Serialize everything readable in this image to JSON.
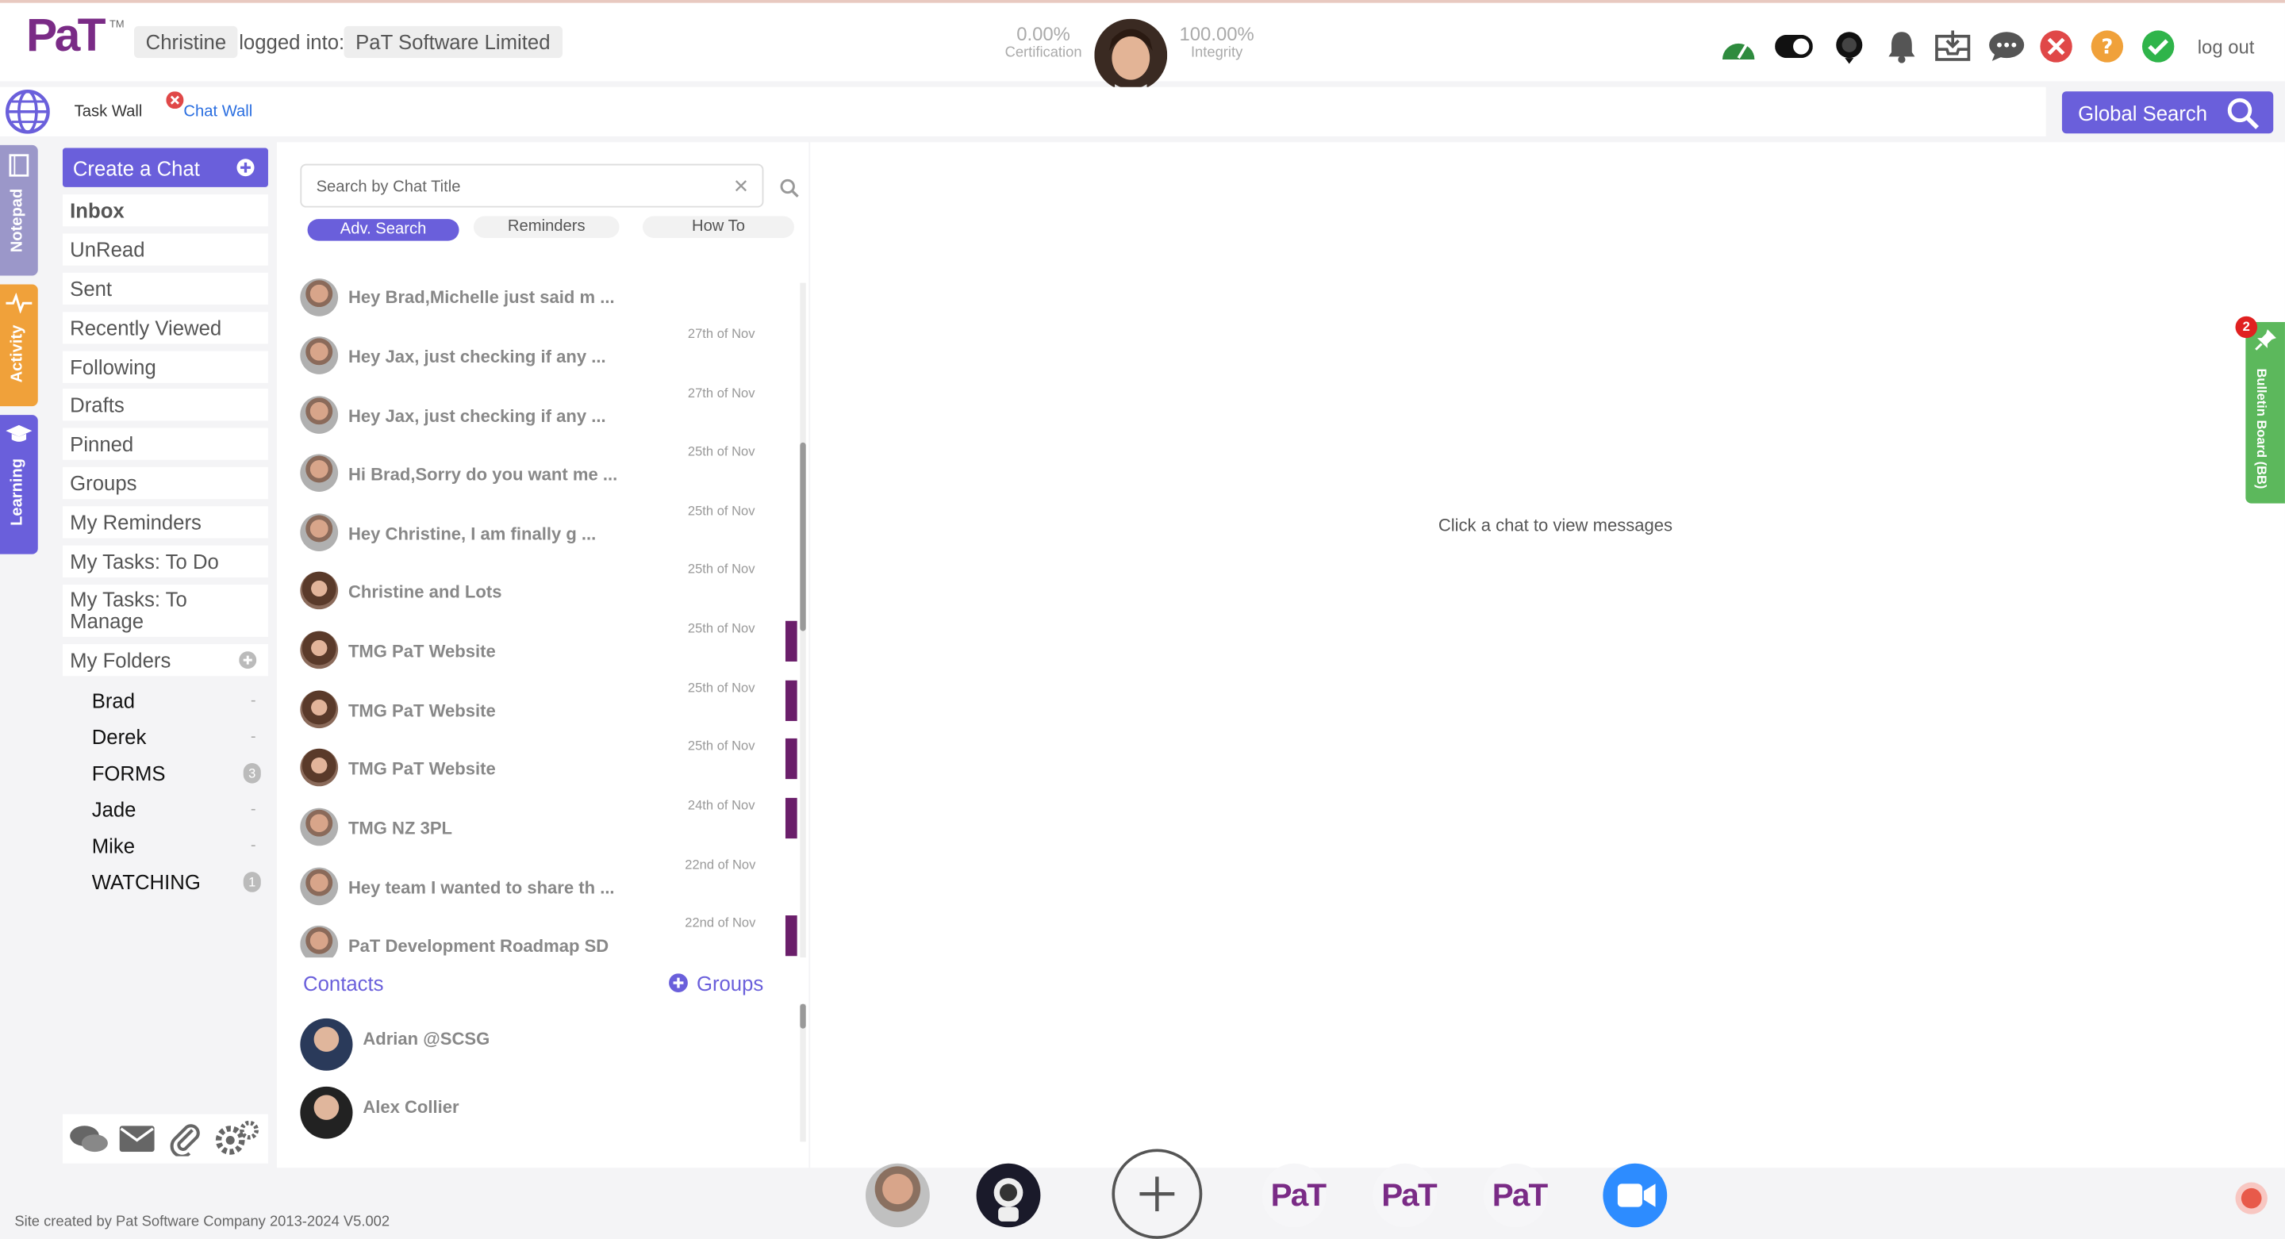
{
  "header": {
    "username": "Christine",
    "logged_into_label": "logged into:",
    "company": "PaT Software Limited",
    "certification_value": "0.00%",
    "certification_label": "Certification",
    "integrity_value": "100.00%",
    "integrity_label": "Integrity",
    "logout_label": "log out",
    "logo_text": "PaT",
    "logo_tm": "TM"
  },
  "subbar": {
    "task_wall": "Task Wall",
    "chat_wall": "Chat Wall",
    "global_search": "Global Search"
  },
  "side_tabs": {
    "notepad": "Notepad",
    "activity": "Activity",
    "learning": "Learning"
  },
  "menu": {
    "create_chat": "Create a Chat",
    "items": [
      "Inbox",
      "UnRead",
      "Sent",
      "Recently Viewed",
      "Following",
      "Drafts",
      "Pinned",
      "Groups",
      "My Reminders",
      "My Tasks: To Do",
      "My Tasks: To Manage",
      "My Folders"
    ],
    "folders": [
      {
        "name": "Brad",
        "badge": "-"
      },
      {
        "name": "Derek",
        "badge": "-"
      },
      {
        "name": "FORMS",
        "badge": "3"
      },
      {
        "name": "Jade",
        "badge": "-"
      },
      {
        "name": "Mike",
        "badge": "-"
      },
      {
        "name": "WATCHING",
        "badge": "1"
      }
    ]
  },
  "chatlist": {
    "search_placeholder": "Search by Chat Title",
    "adv_search": "Adv. Search",
    "reminders": "Reminders",
    "how_to": "How To",
    "chats": [
      {
        "title": "Hey Brad,Michelle just said m ...",
        "date": "27th of Nov",
        "avatar": "man",
        "flag": false
      },
      {
        "title": "Hey Jax, just checking if any ...",
        "date": "27th of Nov",
        "avatar": "man",
        "flag": false
      },
      {
        "title": "Hey Jax, just checking if any ...",
        "date": "25th of Nov",
        "avatar": "man",
        "flag": false
      },
      {
        "title": "Hi Brad,Sorry do you want me ...",
        "date": "25th of Nov",
        "avatar": "man",
        "flag": false
      },
      {
        "title": "Hey Christine, I am finally g ...",
        "date": "25th of Nov",
        "avatar": "man",
        "flag": false
      },
      {
        "title": "Christine and Lots",
        "date": "25th of Nov",
        "avatar": "woman",
        "flag": false
      },
      {
        "title": "TMG PaT Website",
        "date": "25th of Nov",
        "avatar": "woman",
        "flag": true
      },
      {
        "title": "TMG PaT Website",
        "date": "25th of Nov",
        "avatar": "woman",
        "flag": true
      },
      {
        "title": "TMG PaT Website",
        "date": "24th of Nov",
        "avatar": "woman",
        "flag": true
      },
      {
        "title": "TMG NZ 3PL",
        "date": "22nd of Nov",
        "avatar": "man",
        "flag": true
      },
      {
        "title": "Hey team I wanted to share th ...",
        "date": "22nd of Nov",
        "avatar": "man",
        "flag": false
      },
      {
        "title": "PaT Development Roadmap SD",
        "date": "",
        "avatar": "man",
        "flag": true
      }
    ],
    "contacts_label": "Contacts",
    "groups_label": "Groups",
    "contacts": [
      "Adrian @SCSG",
      "Alex Collier"
    ]
  },
  "main": {
    "empty_message": "Click a chat to view messages"
  },
  "bulletin": {
    "label": "Bulletin Board (BB)",
    "badge": "2"
  },
  "footer": {
    "credit": "Site created by Pat Software Company 2013-2024 V5.002"
  },
  "colors": {
    "accent": "#6a5fdb",
    "purple_flag": "#6b1f6b",
    "activity_tab": "#f0a13a",
    "notepad_tab": "#9b97c9",
    "learning_tab": "#6a5fdb",
    "bulletin": "#5cb85c"
  }
}
